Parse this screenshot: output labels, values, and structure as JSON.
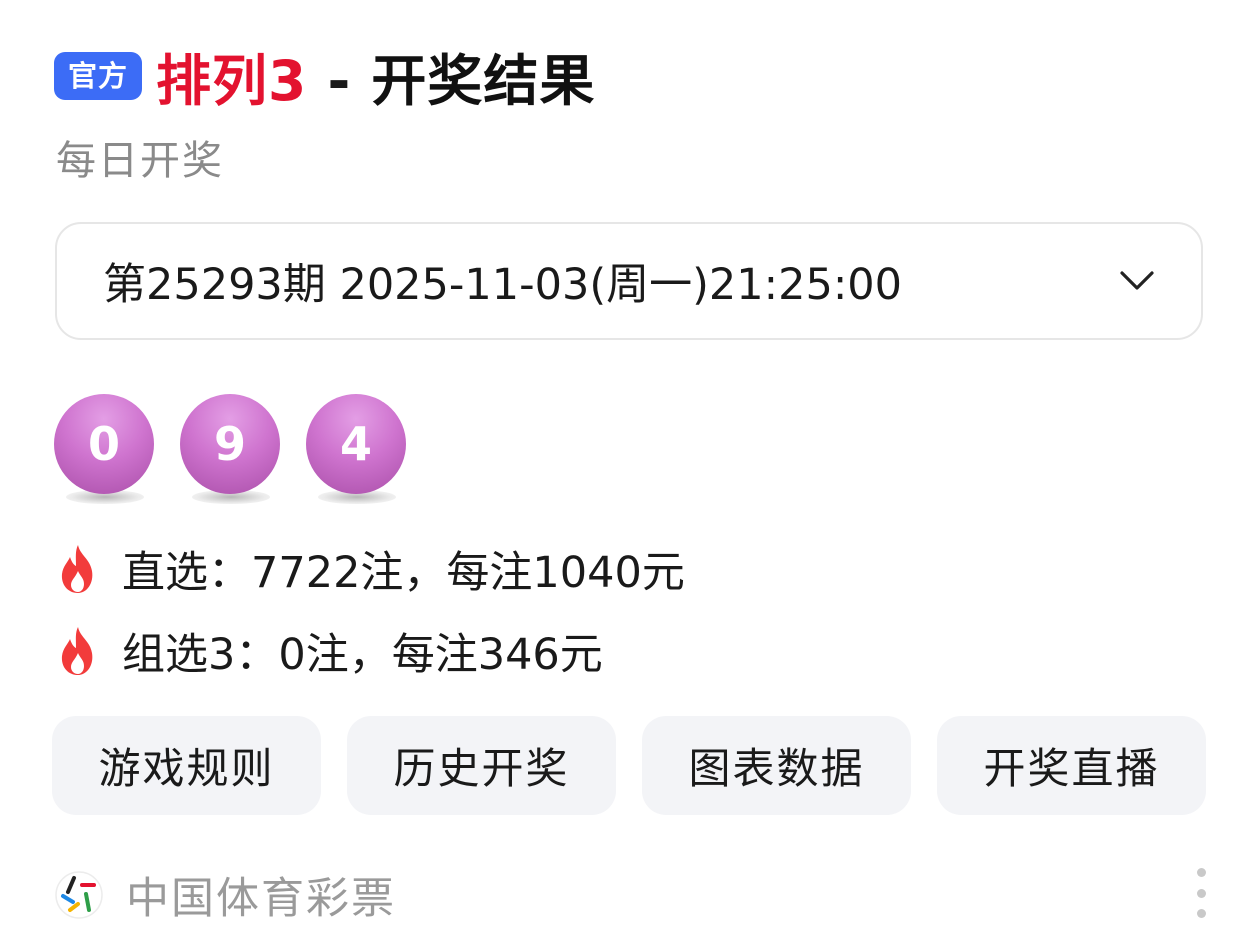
{
  "header": {
    "badge": "官方",
    "game_name": "排列3",
    "separator": " - ",
    "title_rest": "开奖结果",
    "subtitle": "每日开奖"
  },
  "period": {
    "selected": "第25293期 2025-11-03(周一)21:25:00",
    "dropdown_icon": "chevron-down-icon"
  },
  "balls": [
    "0",
    "9",
    "4"
  ],
  "prizes": [
    {
      "icon": "fire-icon",
      "text": "直选：7722注，每注1040元"
    },
    {
      "icon": "fire-icon",
      "text": "组选3：0注，每注346元"
    }
  ],
  "actions": [
    "游戏规则",
    "历史开奖",
    "图表数据",
    "开奖直播"
  ],
  "footer": {
    "source": "中国体育彩票",
    "logo_icon": "china-sports-lottery-logo-icon",
    "more_icon": "more-vertical-icon"
  },
  "colors": {
    "badge_bg": "#3C6CF6",
    "game_name": "#E3122F",
    "ball": "#CF74CF",
    "fire": "#F23B3B",
    "button_bg": "#F3F4F7"
  }
}
